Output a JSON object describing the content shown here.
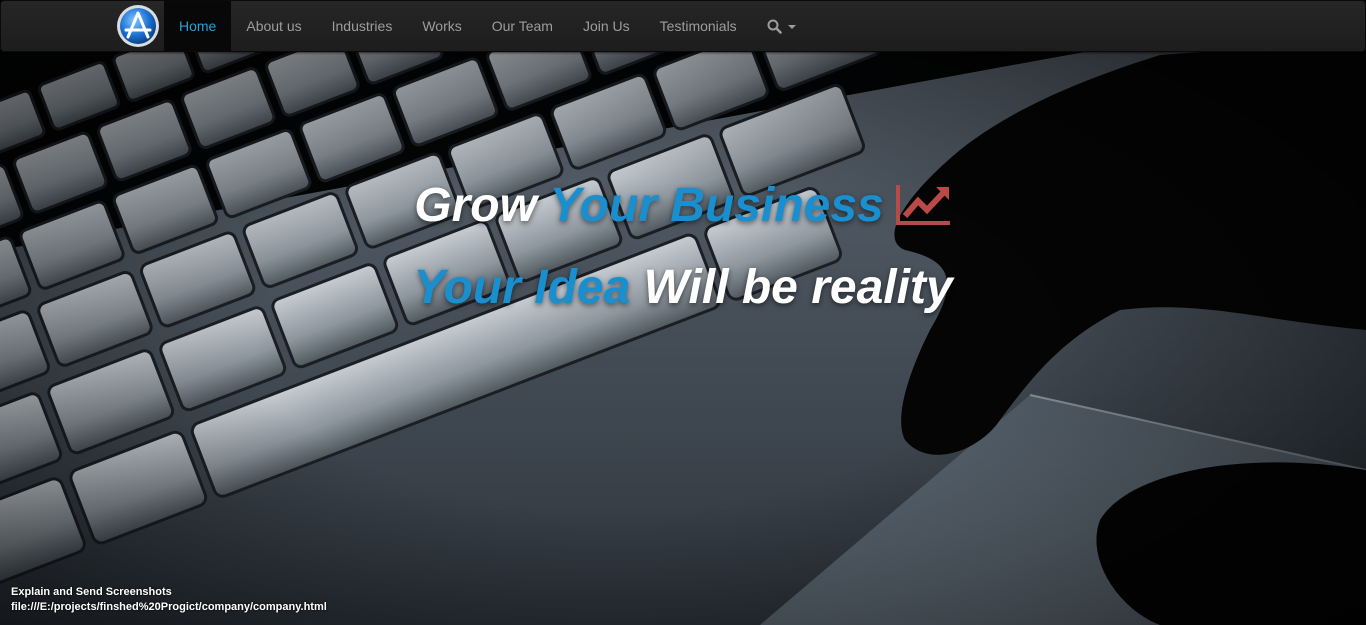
{
  "nav": {
    "logo_icon": "app-store-logo",
    "items": [
      {
        "label": "Home",
        "active": true
      },
      {
        "label": "About us"
      },
      {
        "label": "Industries"
      },
      {
        "label": "Works"
      },
      {
        "label": "Our Team"
      },
      {
        "label": "Join Us"
      },
      {
        "label": "Testimonials"
      }
    ],
    "search_icon": "search-icon"
  },
  "hero": {
    "line1": {
      "part1": "Grow ",
      "part2": "Your Business"
    },
    "line2": {
      "part1": "Your Idea",
      "part2": " Will be reality"
    },
    "icon": "line-chart-icon"
  },
  "status": {
    "title": "Explain and Send Screenshots",
    "url": "file:///E:/projects/finshed%20Progict/company/company.html"
  },
  "colors": {
    "accent_blue": "#1a8fd0",
    "nav_active": "#2a9fd6",
    "icon_red": "#b94a48"
  }
}
